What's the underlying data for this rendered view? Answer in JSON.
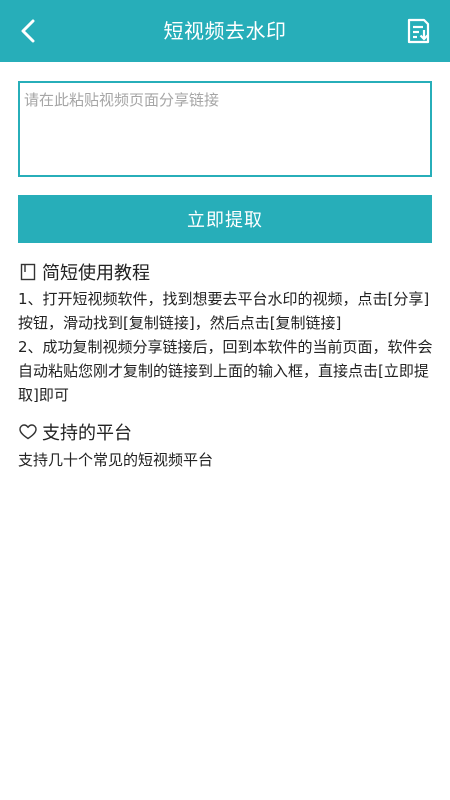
{
  "header": {
    "title": "短视频去水印",
    "back_icon": "chevron-left-icon",
    "list_icon": "download-list-icon",
    "background": "#27aeb9"
  },
  "input": {
    "placeholder": "请在此粘贴视频页面分享链接",
    "value": ""
  },
  "extract_button": {
    "label": "立即提取"
  },
  "tutorial": {
    "title": "简短使用教程",
    "icon": "bookmark-icon",
    "steps": [
      "1、打开短视频软件，找到想要去平台水印的视频，点击[分享]按钮，滑动找到[复制链接]，然后点击[复制链接]",
      "2、成功复制视频分享链接后，回到本软件的当前页面，软件会自动粘贴您刚才复制的链接到上面的输入框，直接点击[立即提取]即可"
    ]
  },
  "platforms": {
    "title": "支持的平台",
    "icon": "heart-icon",
    "text": "支持几十个常见的短视频平台"
  }
}
